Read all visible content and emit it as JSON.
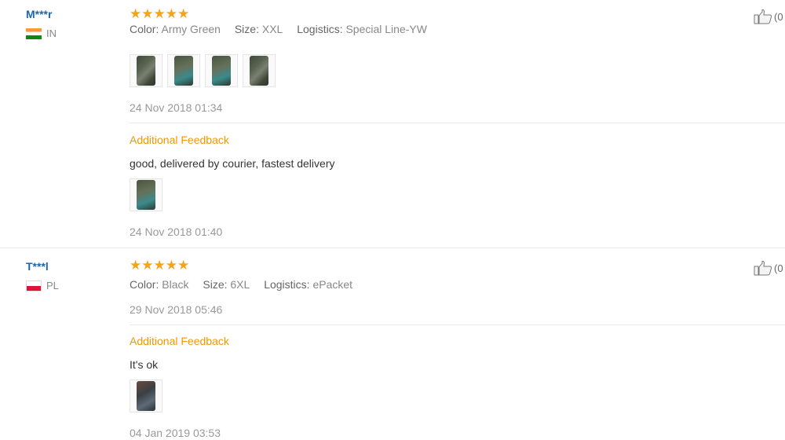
{
  "reviews": [
    {
      "user": "M***r",
      "country": "IN",
      "stars": "★★★★★",
      "color_label": "Color:",
      "color_value": "Army Green",
      "size_label": "Size:",
      "size_value": "XXL",
      "logistics_label": "Logistics:",
      "logistics_value": "Special Line-YW",
      "date": "24 Nov 2018 01:34",
      "additional_title": "Additional Feedback",
      "additional_text": "good, delivered by courier, fastest delivery",
      "additional_date": "24 Nov 2018 01:40",
      "likes": "(0"
    },
    {
      "user": "T***l",
      "country": "PL",
      "stars": "★★★★★",
      "color_label": "Color:",
      "color_value": "Black",
      "size_label": "Size:",
      "size_value": "6XL",
      "logistics_label": "Logistics:",
      "logistics_value": "ePacket",
      "date": "29 Nov 2018 05:46",
      "additional_title": "Additional Feedback",
      "additional_text": "It's ok",
      "additional_date": "04 Jan 2019 03:53",
      "likes": "(0"
    }
  ],
  "colors": {
    "username": "#1a66b0",
    "stars": "#f7a21b",
    "additional_title": "#f39800"
  },
  "icons": {
    "like": "thumbs-up-icon",
    "flag_in": "india-flag-icon",
    "flag_pl": "poland-flag-icon"
  }
}
